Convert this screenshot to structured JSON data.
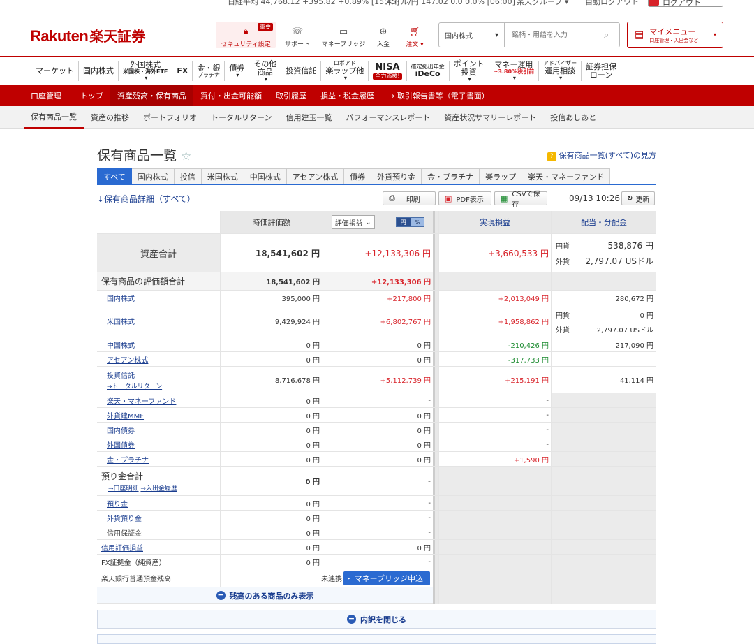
{
  "topstrip": {
    "market_text": "日経平均 44,768.12 +395.82 +0.89% [15:45]",
    "fx_text": "米ドル/円 147.02 0.0 0.0% [06:00]",
    "group_text": "楽天グループ ▾",
    "auto_logout": "自動ログアウト",
    "logout": "ログアウト"
  },
  "header": {
    "logo_en": "Rakuten",
    "logo_jp": "楽天証券",
    "icons": [
      {
        "label": "セキュリティ設定",
        "icon": "lock-icon",
        "badge": "重要"
      },
      {
        "label": "サポート",
        "icon": "support-icon"
      },
      {
        "label": "マネーブリッジ",
        "icon": "bank-icon"
      },
      {
        "label": "入金",
        "icon": "deposit-icon"
      },
      {
        "label": "注文 ▾",
        "icon": "cart-icon"
      }
    ],
    "search_select": "国内株式",
    "search_placeholder": "銘柄・用語を入力",
    "mymenu_title": "マイメニュー",
    "mymenu_sub": "口座管理・入出金など"
  },
  "gnav": [
    {
      "main": "マーケット"
    },
    {
      "main": "国内株式"
    },
    {
      "main": "外国株式",
      "sub": "米国株・海外ETF"
    },
    {
      "main": "FX"
    },
    {
      "main": "金・銀",
      "sub": "プラチナ"
    },
    {
      "main": "債券"
    },
    {
      "main": "その他",
      "sub": "商品"
    },
    {
      "main": "投資信託"
    },
    {
      "main": "楽ラップ他",
      "sub": "ロボアド"
    },
    {
      "main": "NISA",
      "sub": "全力応援!"
    },
    {
      "main": "iDeCo",
      "sub": "確定拠出年金"
    },
    {
      "main": "投資",
      "sub": "ポイント"
    },
    {
      "main": "~3.80%税引前",
      "sub": "マネー運用"
    },
    {
      "main": "運用相談",
      "sub": "アドバイザー"
    },
    {
      "main": "ローン",
      "sub": "証券担保"
    }
  ],
  "redbar": [
    "口座管理",
    "トップ",
    "資産残高・保有商品",
    "買付・出金可能額",
    "取引履歴",
    "損益・税金履歴",
    "→ 取引報告書等（電子書面）"
  ],
  "subnav": [
    "保有商品一覧",
    "資産の推移",
    "ポートフォリオ",
    "トータルリターン",
    "信用建玉一覧",
    "パフォーマンスレポート",
    "資産状況サマリーレポート",
    "投信あしあと"
  ],
  "page": {
    "title": "保有商品一覧",
    "howto": "保有商品一覧(すべて)の見方",
    "tabs": [
      "すべて",
      "国内株式",
      "投信",
      "米国株式",
      "中国株式",
      "アセアン株式",
      "債券",
      "外貨預り金",
      "金・プラチナ",
      "楽ラップ",
      "楽天・マネーファンド"
    ],
    "detail_link": "↓保有商品詳細（すべて）",
    "print": "印刷",
    "pdf": "PDF表示",
    "csv": "CSVで保存",
    "timestamp": "09/13 10:26",
    "refresh": "更新"
  },
  "table": {
    "headers": {
      "value": "時価評価額",
      "pl_select": "評価損益",
      "toggle_yen": "円",
      "toggle_pct": "%",
      "realized": "実現損益",
      "dividend": "配当・分配金"
    },
    "total": {
      "label": "資産合計",
      "value": "18,541,602 円",
      "pl": "+12,133,306 円",
      "realized": "+3,660,533 円",
      "div_yen_label": "円貨",
      "div_yen": "538,876 円",
      "div_fx_label": "外貨",
      "div_fx": "2,797.07 USドル"
    },
    "holdings_total": {
      "label": "保有商品の評価額合計",
      "value": "18,541,602 円",
      "pl": "+12,133,306 円"
    },
    "items": [
      {
        "label": "国内株式",
        "value": "395,000 円",
        "pl": "+217,800 円",
        "realized": "+2,013,049 円",
        "div": "280,672 円"
      },
      {
        "label": "米国株式",
        "value": "9,429,924 円",
        "pl": "+6,802,767 円",
        "realized": "+1,958,862 円",
        "div_yen_label": "円貨",
        "div_yen": "0 円",
        "div_fx_label": "外貨",
        "div_fx": "2,797.07 USドル"
      },
      {
        "label": "中国株式",
        "value": "0 円",
        "pl": "0 円",
        "realized": "-210,426 円",
        "div": "217,090 円"
      },
      {
        "label": "アセアン株式",
        "value": "0 円",
        "pl": "0 円",
        "realized": "-317,733 円",
        "div": ""
      },
      {
        "label": "投資信託",
        "sub": "→トータルリターン",
        "value": "8,716,678 円",
        "pl": "+5,112,739 円",
        "realized": "+215,191 円",
        "div": "41,114 円"
      },
      {
        "label": "楽天・マネーファンド",
        "value": "0 円",
        "pl": "-",
        "realized": "-"
      },
      {
        "label": "外貨建MMF",
        "value": "0 円",
        "pl": "0 円",
        "realized": "-"
      },
      {
        "label": "国内債券",
        "value": "0 円",
        "pl": "0 円",
        "realized": "-"
      },
      {
        "label": "外国債券",
        "value": "0 円",
        "pl": "0 円",
        "realized": "-"
      },
      {
        "label": "金・プラチナ",
        "value": "0 円",
        "pl": "0 円",
        "realized": "+1,590 円"
      }
    ],
    "deposits": {
      "label": "預り金合計",
      "sub1": "→口座明細",
      "sub2": "→入出金履歴",
      "value": "0 円",
      "pl": "-"
    },
    "deposit_items": [
      {
        "label": "預り金",
        "value": "0 円",
        "pl": "-"
      },
      {
        "label": "外貨預り金",
        "value": "0 円",
        "pl": "-"
      },
      {
        "label": "信用保証金",
        "value": "0 円",
        "pl": "-"
      }
    ],
    "margin_pl": {
      "label": "信用評価損益",
      "value": "0 円",
      "pl": "0 円"
    },
    "fx_margin": {
      "label": "FX証拠金（純資産）",
      "value": "0 円",
      "pl": "-"
    },
    "bank": {
      "label": "楽天銀行普通預金残高",
      "status": "未連携",
      "button": "マネーブリッジ申込"
    },
    "show_balance_only": "残高のある商品のみ表示",
    "close_breakdown": "内訳を閉じる"
  }
}
